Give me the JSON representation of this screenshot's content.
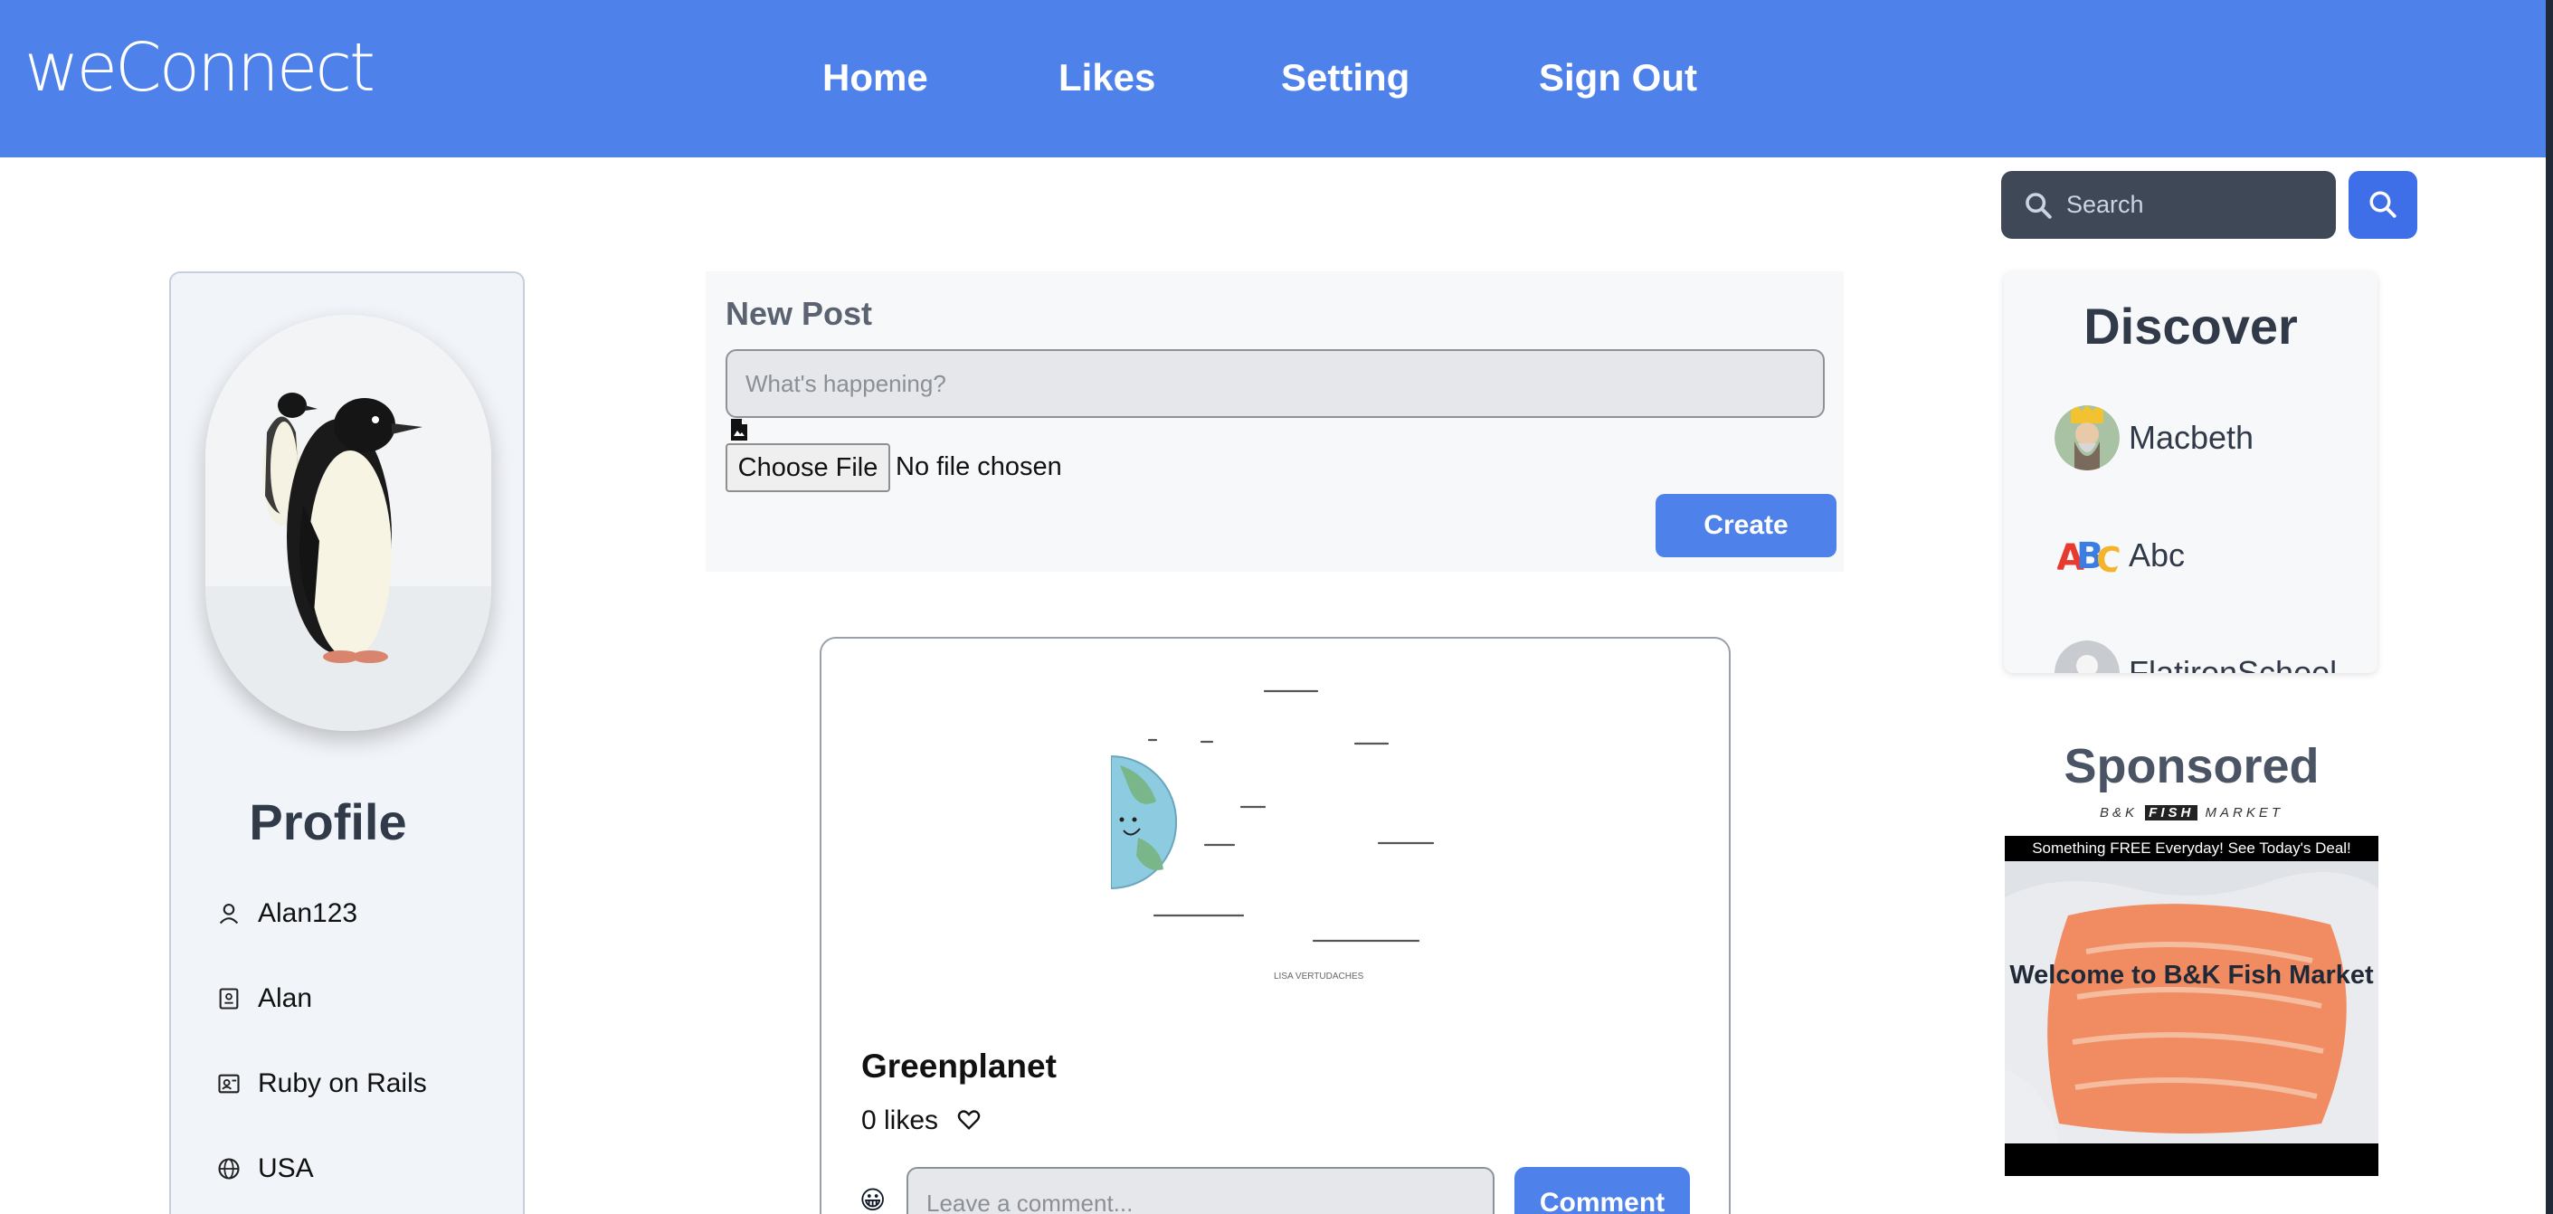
{
  "navbar": {
    "logo": "weConnect",
    "links": [
      "Home",
      "Likes",
      "Setting",
      "Sign Out"
    ]
  },
  "search": {
    "placeholder": "Search"
  },
  "profile": {
    "title": "Profile",
    "username": "Alan123",
    "name": "Alan",
    "occupation": "Ruby on Rails",
    "location": "USA"
  },
  "new_post": {
    "title": "New Post",
    "placeholder": "What's happening?",
    "choose_file_label": "Choose File",
    "file_status": "No file chosen",
    "create_label": "Create"
  },
  "post": {
    "title": "Greenplanet",
    "likes_text": "0 likes",
    "image_caption": "LISA VERTUDACHES",
    "comment_placeholder": "Leave a comment...",
    "comment_label": "Comment",
    "emoji": "😀"
  },
  "discover": {
    "title": "Discover",
    "users": [
      {
        "name": "Macbeth"
      },
      {
        "name": "Abc"
      },
      {
        "name": "FlatironSchool"
      }
    ]
  },
  "sponsored": {
    "title": "Sponsored",
    "brand_left": "B&K",
    "brand_mid": "FISH",
    "brand_right": "MARKET",
    "top_banner": "Something FREE Everyday! See Today's Deal!",
    "headline": "Welcome to B&K Fish Market"
  },
  "colors": {
    "primary": "#4f81ea",
    "search_bg": "#3f4856",
    "heading": "#313a49"
  }
}
